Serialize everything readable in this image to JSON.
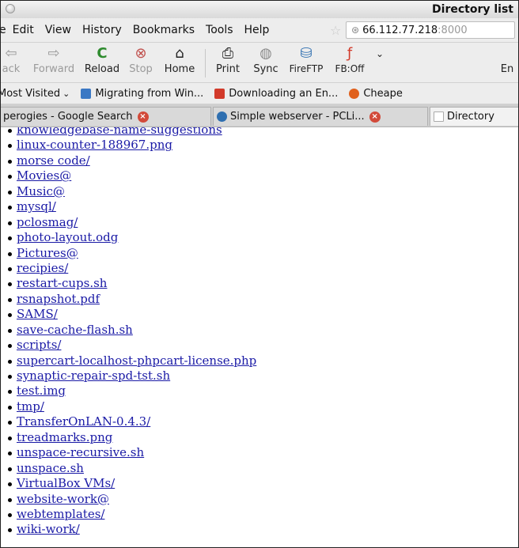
{
  "window": {
    "title": "Directory list"
  },
  "menu": {
    "first": "e",
    "items": [
      {
        "label": "Edit"
      },
      {
        "label": "View"
      },
      {
        "label": "History"
      },
      {
        "label": "Bookmarks"
      },
      {
        "label": "Tools"
      },
      {
        "label": "Help"
      }
    ]
  },
  "address": {
    "host": "66.112.77.218",
    "port": ":8000"
  },
  "toolbar": {
    "back": "ack",
    "forward": "Forward",
    "reload": "Reload",
    "stop": "Stop",
    "home": "Home",
    "print": "Print",
    "sync": "Sync",
    "fireftp": "FireFTP",
    "fb": "FB:Off",
    "en": "En"
  },
  "bookmarks": {
    "most_visited": "Most Visited",
    "items": [
      {
        "label": "Migrating from Win..."
      },
      {
        "label": "Downloading an En..."
      },
      {
        "label": "Cheape"
      }
    ]
  },
  "tabs": [
    {
      "title": "perogies - Google Search"
    },
    {
      "title": "Simple webserver - PCLi..."
    },
    {
      "title": "Directory"
    }
  ],
  "listing": [
    "knowledgebase-name-suggestions",
    "linux-counter-188967.png",
    "morse code/",
    "Movies@",
    "Music@",
    "mysql/",
    "pclosmag/",
    "photo-layout.odg",
    "Pictures@",
    "recipies/",
    "restart-cups.sh",
    "rsnapshot.pdf",
    "SAMS/",
    "save-cache-flash.sh",
    "scripts/",
    "supercart-localhost-phpcart-license.php",
    "synaptic-repair-spd-tst.sh",
    "test.img",
    "tmp/",
    "TransferOnLAN-0.4.3/",
    "treadmarks.png",
    "unspace-recursive.sh",
    "unspace.sh",
    "VirtualBox VMs/",
    "website-work@",
    "webtemplates/",
    "wiki-work/"
  ],
  "colors": {
    "link": "#1a1aa6",
    "tab_close": "#d24a3a",
    "reload": "#2e8b2e",
    "stop": "#c0504d"
  }
}
